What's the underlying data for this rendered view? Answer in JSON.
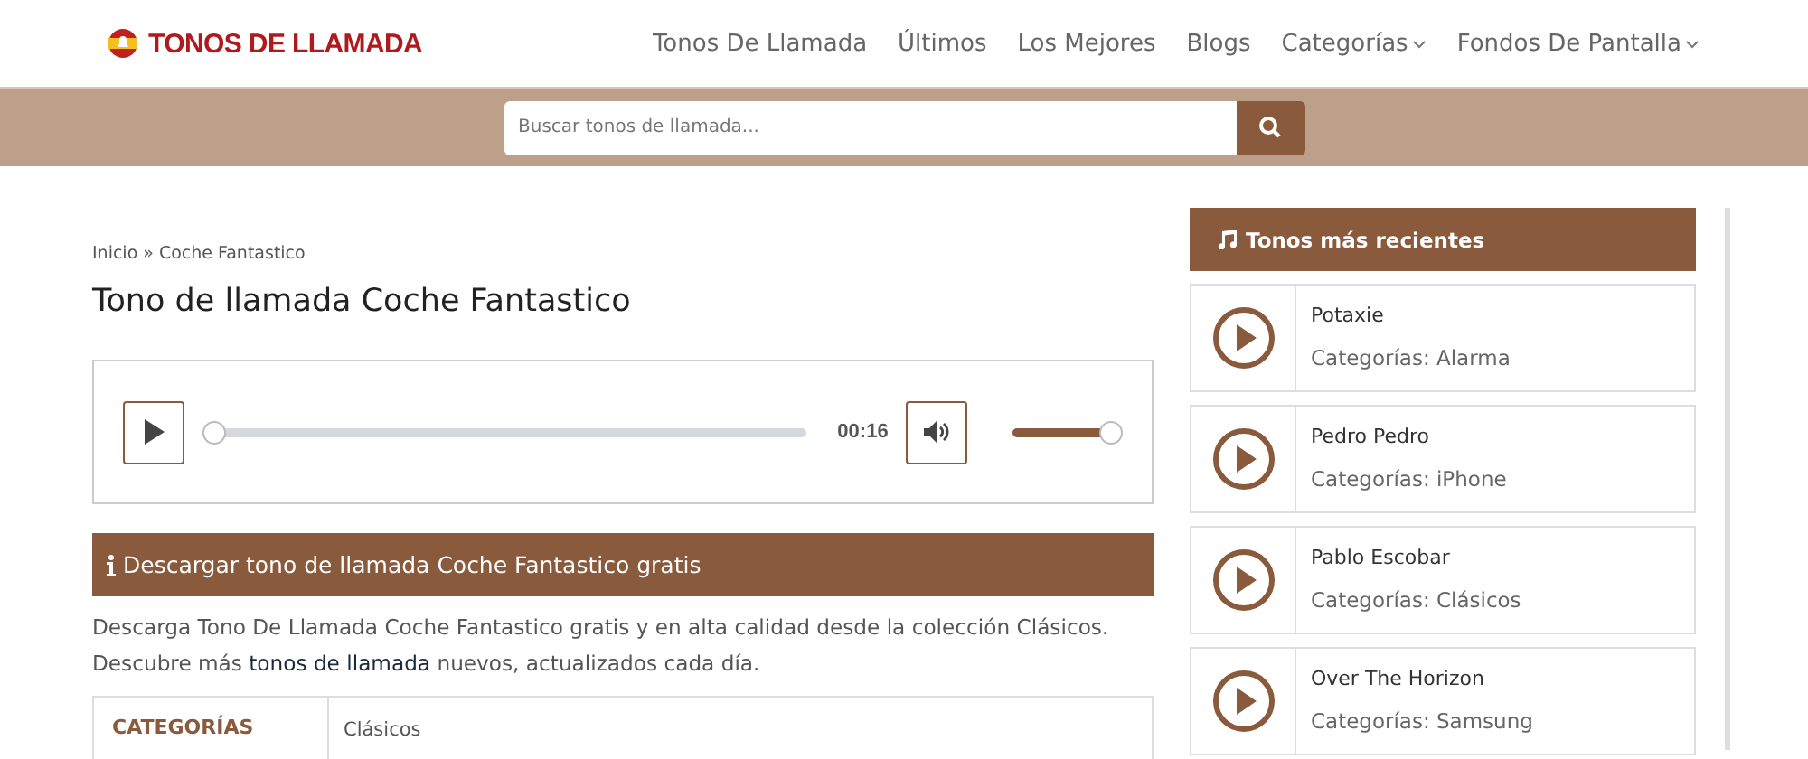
{
  "header": {
    "logo": "TONOS DE LLAMADA",
    "nav": [
      {
        "label": "Tonos De Llamada",
        "dropdown": false
      },
      {
        "label": "Últimos",
        "dropdown": false
      },
      {
        "label": "Los Mejores",
        "dropdown": false
      },
      {
        "label": "Blogs",
        "dropdown": false
      },
      {
        "label": "Categorías",
        "dropdown": true
      },
      {
        "label": "Fondos De Pantalla",
        "dropdown": true
      }
    ]
  },
  "search": {
    "placeholder": "Buscar tonos de llamada..."
  },
  "breadcrumb": {
    "items": [
      "Inicio",
      "Coche Fantastico"
    ],
    "separator": "»"
  },
  "title": "Tono de llamada Coche Fantastico",
  "player": {
    "progress": {
      "level": 0
    },
    "time": "00:16",
    "volume": {
      "level": 1
    }
  },
  "download_banner": "Descargar tono de llamada Coche Fantastico gratis",
  "description": {
    "before": "Descarga Tono De Llamada Coche Fantastico gratis y en alta calidad desde la colección Clásicos. Descubre más ",
    "link": "tonos de llamada",
    "after": " nuevos, actualizados cada día."
  },
  "details": [
    {
      "label": "CATEGORÍAS",
      "value": "Clásicos"
    }
  ],
  "sidebar": {
    "title": "Tonos más recientes",
    "items": [
      {
        "name": "Potaxie",
        "category": "Categorías: Alarma"
      },
      {
        "name": "Pedro Pedro",
        "category": "Categorías: iPhone"
      },
      {
        "name": "Pablo Escobar",
        "category": "Categorías: Clásicos"
      },
      {
        "name": "Over The Horizon",
        "category": "Categorías: Samsung"
      }
    ]
  }
}
